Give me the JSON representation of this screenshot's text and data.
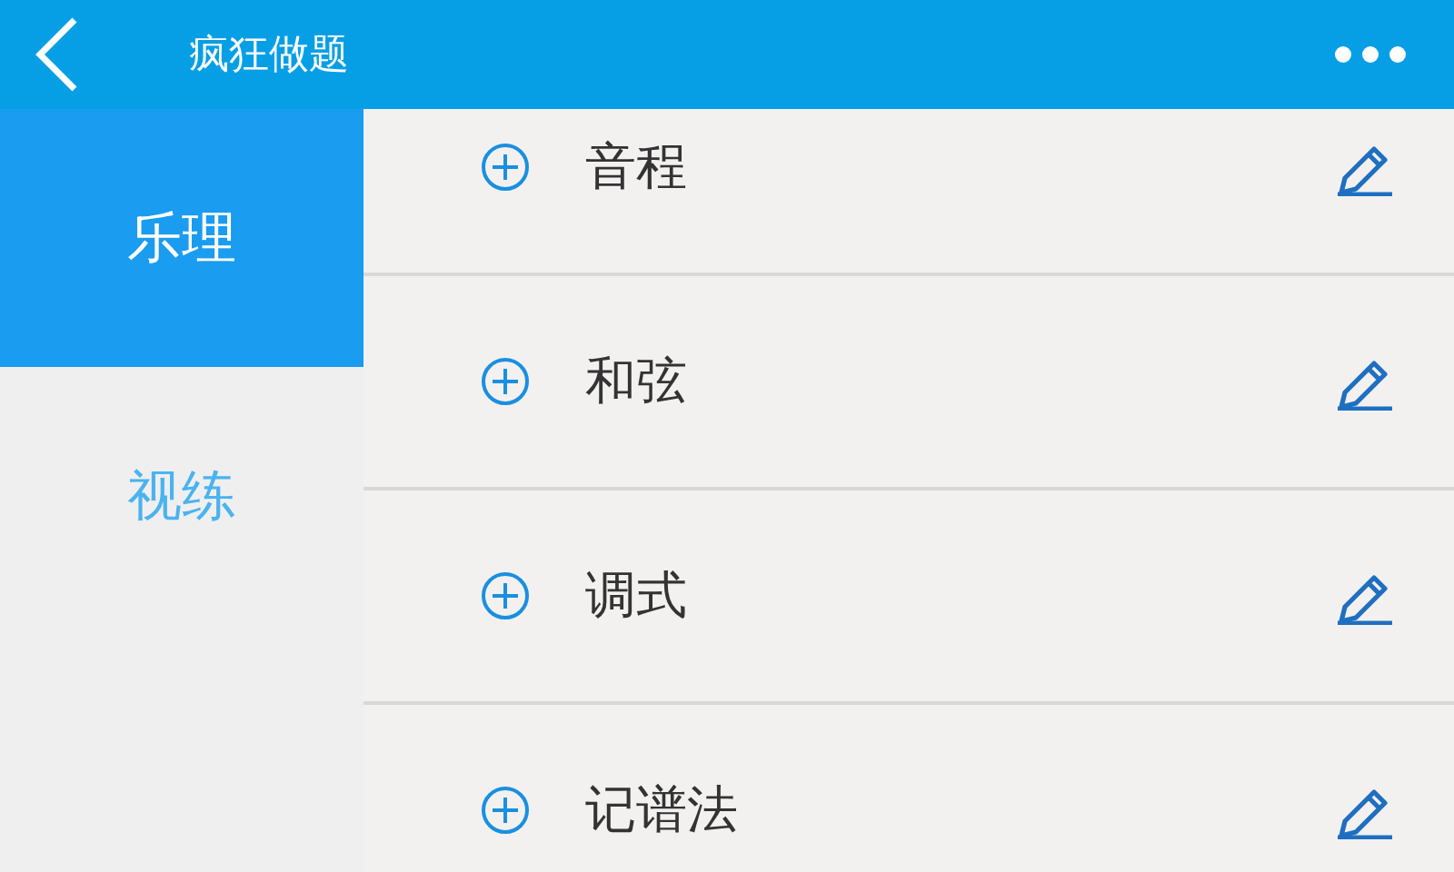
{
  "header": {
    "title": "疯狂做题"
  },
  "sidebar": {
    "items": [
      {
        "label": "乐理",
        "selected": true
      },
      {
        "label": "视练",
        "selected": false
      }
    ]
  },
  "topics": [
    {
      "label": "音程"
    },
    {
      "label": "和弦"
    },
    {
      "label": "调式"
    },
    {
      "label": "记谱法"
    }
  ]
}
